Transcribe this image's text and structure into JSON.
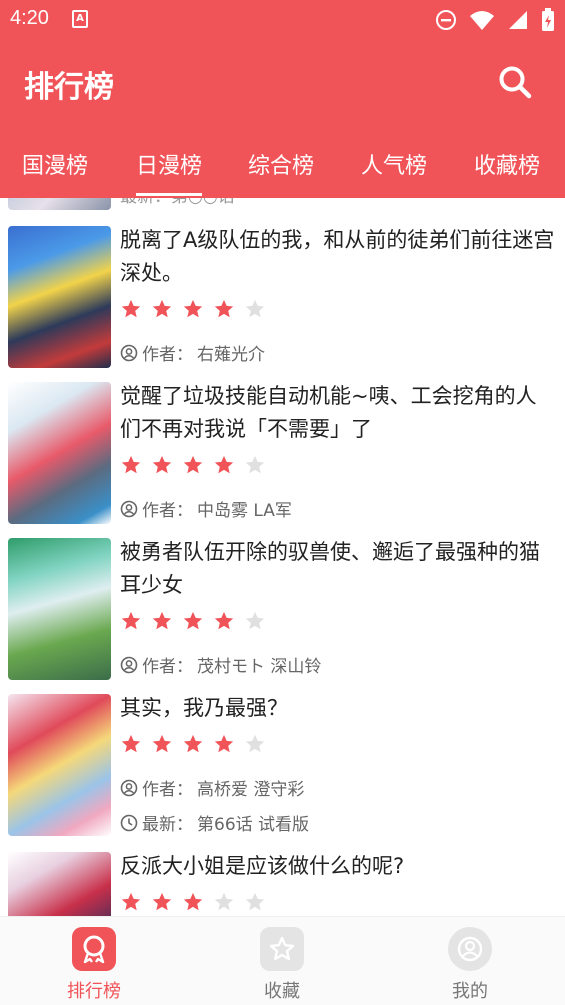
{
  "status_bar": {
    "time": "4:20",
    "sim_label": "A"
  },
  "app_bar": {
    "title": "排行榜"
  },
  "tabs": [
    {
      "label": "国漫榜"
    },
    {
      "label": "日漫榜"
    },
    {
      "label": "综合榜"
    },
    {
      "label": "人气榜"
    },
    {
      "label": "收藏榜"
    }
  ],
  "active_tab": "日漫榜",
  "partial_item_text": "最新：第○○话",
  "items": [
    {
      "title": "脱离了A级队伍的我，和从前的徒弟们前往迷宫深处。",
      "rating": 4,
      "author_prefix": "作者：",
      "author": "右薙光介"
    },
    {
      "title": "觉醒了垃圾技能自动机能~咦、工会挖角的人们不再对我说「不需要」了",
      "rating": 4,
      "author_prefix": "作者：",
      "author": "中岛雾 LA军"
    },
    {
      "title": "被勇者队伍开除的驭兽使、邂逅了最强种的猫耳少女",
      "rating": 4,
      "author_prefix": "作者：",
      "author": "茂村モト 深山铃"
    },
    {
      "title": "其实，我乃最强？",
      "rating": 4,
      "author_prefix": "作者：",
      "author": "高桥爱 澄守彩",
      "latest_prefix": "最新：",
      "latest": "第66话 试看版"
    },
    {
      "title": "反派大小姐是应该做什么的呢?",
      "rating": 3
    }
  ],
  "bottom_nav": [
    {
      "label": "排行榜",
      "icon": "ranking-icon",
      "active": true
    },
    {
      "label": "收藏",
      "icon": "star-icon",
      "active": false
    },
    {
      "label": "我的",
      "icon": "user-icon",
      "active": false
    }
  ],
  "colors": {
    "primary": "#f05458",
    "star_on": "#f05458",
    "star_off": "#e0e0e0",
    "nav_inactive": "#777777"
  }
}
